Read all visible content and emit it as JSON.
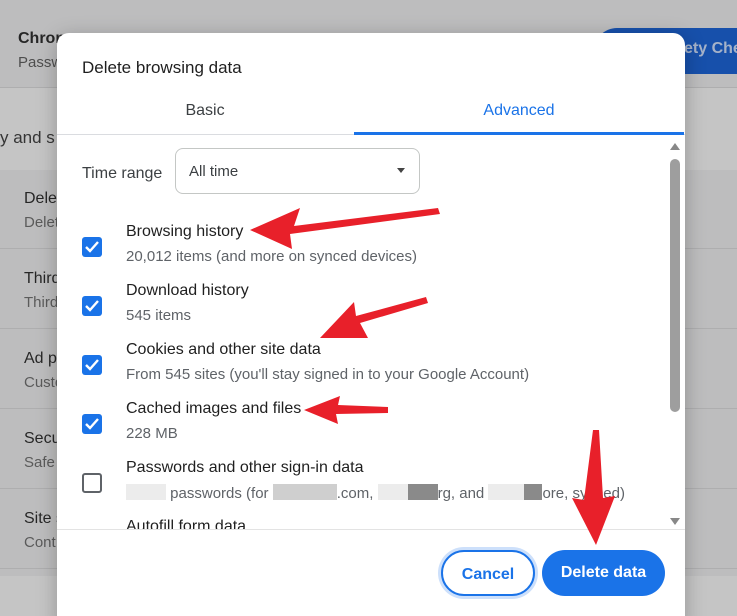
{
  "background": {
    "header_title_fragment": "Chron",
    "header_sub_fragment": "Passw",
    "header_button_fragment": "ety Chec",
    "section_fragment": "y and s",
    "rows": [
      {
        "title": "Delet",
        "sub": "Delet"
      },
      {
        "title": "Third",
        "sub": "Third"
      },
      {
        "title": "Ad p",
        "sub": "Custo"
      },
      {
        "title": "Secu",
        "sub": "Safe"
      },
      {
        "title": "Site s",
        "sub": "Cont"
      }
    ]
  },
  "dialog": {
    "title": "Delete browsing data",
    "tabs": [
      {
        "label": "Basic",
        "selected": false
      },
      {
        "label": "Advanced",
        "selected": true
      }
    ],
    "time_range": {
      "label": "Time range",
      "value": "All time"
    },
    "items": [
      {
        "label": "Browsing history",
        "sub": "20,012 items (and more on synced devices)",
        "checked": true
      },
      {
        "label": "Download history",
        "sub": "545 items",
        "checked": true
      },
      {
        "label": "Cookies and other site data",
        "sub": "From 545 sites (you'll stay signed in to your Google Account)",
        "checked": true
      },
      {
        "label": "Cached images and files",
        "sub": "228 MB",
        "checked": true
      },
      {
        "label": "Passwords and other sign-in data",
        "sub_parts": [
          "passwords (for",
          ".com,",
          "rg, and",
          "ore, synced)"
        ],
        "checked": false
      },
      {
        "label": "Autofill form data",
        "checked": false
      }
    ],
    "buttons": {
      "cancel": "Cancel",
      "delete": "Delete data"
    }
  },
  "colors": {
    "accent": "#1a73e8",
    "annotation_arrow": "#e8202a"
  }
}
